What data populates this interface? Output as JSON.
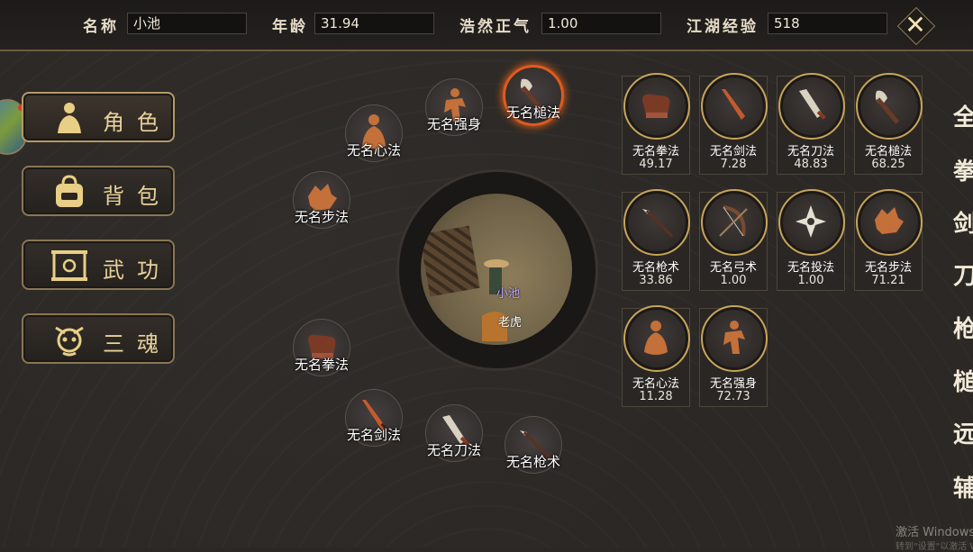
{
  "header": {
    "name_label": "名称",
    "name_value": "小池",
    "age_label": "年龄",
    "age_value": "31.94",
    "righteous_label": "浩然正气",
    "righteous_value": "1.00",
    "exp_label": "江湖经验",
    "exp_value": "518",
    "close_glyph": "✕"
  },
  "menu": [
    {
      "label": "角色",
      "icon": "character-icon"
    },
    {
      "label": "背包",
      "icon": "bag-icon"
    },
    {
      "label": "武功",
      "icon": "scroll-icon"
    },
    {
      "label": "三魂",
      "icon": "souls-icon"
    }
  ],
  "ring_nodes": [
    {
      "label": "无名心法",
      "icon": "meditation-icon"
    },
    {
      "label": "无名强身",
      "icon": "fighter-icon"
    },
    {
      "label": "无名槌法",
      "icon": "axe-icon",
      "highlighted": true
    },
    {
      "label": "无名步法",
      "icon": "boar-icon"
    },
    {
      "label": "无名拳法",
      "icon": "gauntlet-icon"
    },
    {
      "label": "无名剑法",
      "icon": "sword-icon"
    },
    {
      "label": "无名刀法",
      "icon": "blade-icon"
    },
    {
      "label": "无名枪术",
      "icon": "spear-icon"
    }
  ],
  "minimap": {
    "player_name": "小池",
    "pet_name": "老虎"
  },
  "skills": [
    {
      "name": "无名拳法",
      "value": "49.17",
      "icon": "gauntlet-icon"
    },
    {
      "name": "无名剑法",
      "value": "7.28",
      "icon": "sword-icon"
    },
    {
      "name": "无名刀法",
      "value": "48.83",
      "icon": "blade-icon"
    },
    {
      "name": "无名槌法",
      "value": "68.25",
      "icon": "axe-icon"
    },
    {
      "name": "无名枪术",
      "value": "33.86",
      "icon": "spear-icon"
    },
    {
      "name": "无名弓术",
      "value": "1.00",
      "icon": "bow-icon"
    },
    {
      "name": "无名投法",
      "value": "1.00",
      "icon": "shuriken-icon"
    },
    {
      "name": "无名步法",
      "value": "71.21",
      "icon": "boar-icon"
    },
    {
      "name": "无名心法",
      "value": "11.28",
      "icon": "meditation-icon"
    },
    {
      "name": "无名强身",
      "value": "72.73",
      "icon": "fighter-icon"
    }
  ],
  "categories": [
    "全",
    "拳",
    "剑",
    "刀",
    "枪",
    "槌",
    "远",
    "辅"
  ],
  "watermark": {
    "line1": "激活 Windows",
    "line2": "转到\"设置\"以激活 W"
  },
  "colors": {
    "accent": "#c7a55a",
    "highlight": "#e05a20",
    "background": "#2a2724"
  }
}
